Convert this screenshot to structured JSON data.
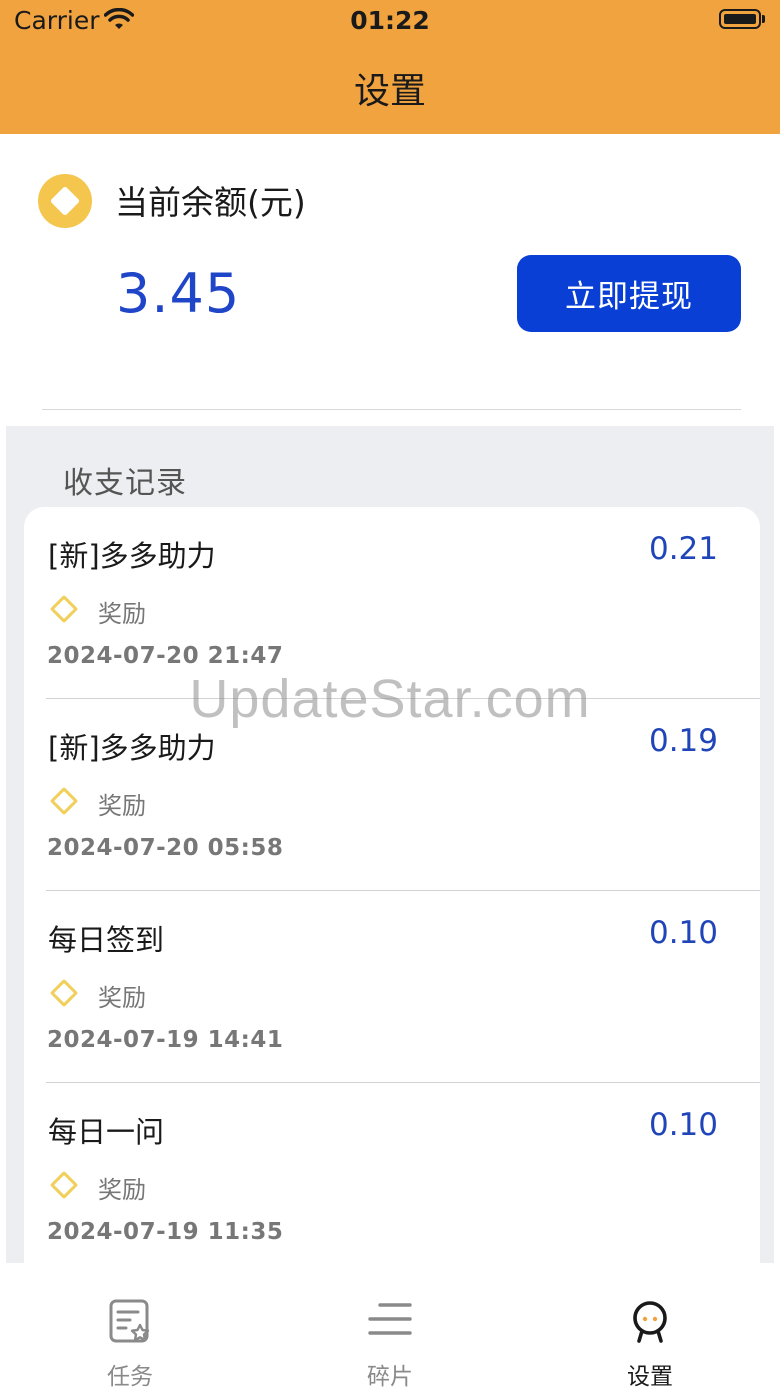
{
  "status_bar": {
    "carrier": "Carrier",
    "time": "01:22"
  },
  "nav": {
    "title": "设置"
  },
  "balance": {
    "label": "当前余额(元)",
    "value": "3.45",
    "withdraw_button": "立即提现"
  },
  "records": {
    "title": "收支记录",
    "items": [
      {
        "title": "[新]多多助力",
        "amount": "0.21",
        "type": "奖励",
        "time": "2024-07-20 21:47"
      },
      {
        "title": "[新]多多助力",
        "amount": "0.19",
        "type": "奖励",
        "time": "2024-07-20 05:58"
      },
      {
        "title": "每日签到",
        "amount": "0.10",
        "type": "奖励",
        "time": "2024-07-19 14:41"
      },
      {
        "title": "每日一问",
        "amount": "0.10",
        "type": "奖励",
        "time": "2024-07-19 11:35"
      }
    ]
  },
  "tabbar": {
    "tabs": [
      {
        "label": "任务",
        "icon": "task-list-icon",
        "active": false
      },
      {
        "label": "碎片",
        "icon": "menu-lines-icon",
        "active": false
      },
      {
        "label": "设置",
        "icon": "profile-icon",
        "active": true
      }
    ]
  },
  "watermark": "UpdateStar.com",
  "colors": {
    "header": "#f0a33f",
    "accent_blue": "#0a3fd6",
    "amount_blue": "#1f45b8",
    "coin_yellow": "#f4c64e"
  }
}
